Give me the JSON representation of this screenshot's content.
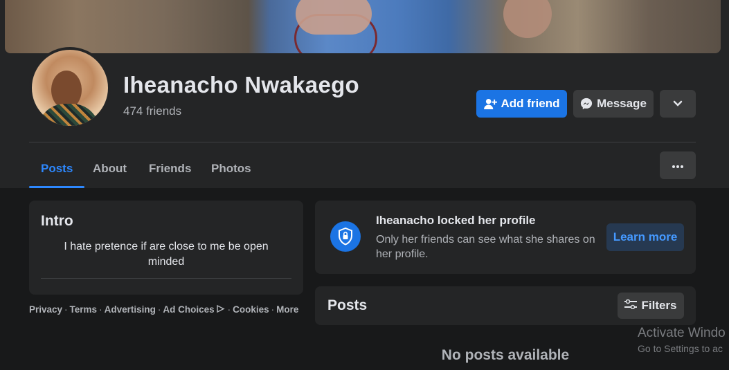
{
  "profile": {
    "name": "Iheanacho Nwakaego",
    "friends_count": "474 friends"
  },
  "actions": {
    "add_friend": "Add friend",
    "message": "Message"
  },
  "tabs": [
    {
      "label": "Posts",
      "active": true
    },
    {
      "label": "About",
      "active": false
    },
    {
      "label": "Friends",
      "active": false
    },
    {
      "label": "Photos",
      "active": false
    }
  ],
  "intro": {
    "title": "Intro",
    "bio": "I hate pretence if are close to me be open minded"
  },
  "footer": {
    "privacy": "Privacy",
    "terms": "Terms",
    "advertising": "Advertising",
    "ad_choices": "Ad Choices",
    "cookies": "Cookies",
    "more": "More"
  },
  "locked_notice": {
    "title": "Iheanacho locked her profile",
    "description": "Only her friends can see what she shares on her profile.",
    "learn_more": "Learn more"
  },
  "posts_section": {
    "title": "Posts",
    "filters_label": "Filters",
    "empty_text": "No posts available"
  },
  "watermark": {
    "line1": "Activate Windo",
    "line2": "Go to Settings to ac"
  },
  "colors": {
    "accent": "#1b74e4",
    "link_blue": "#2d88ff",
    "background": "#18191a",
    "card": "#242526"
  }
}
